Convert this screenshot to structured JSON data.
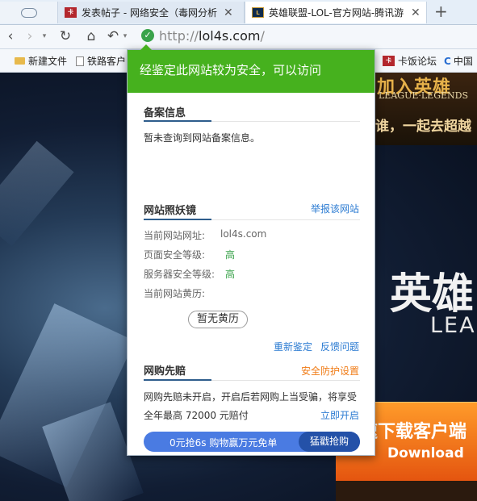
{
  "tabs": [
    {
      "label": "发表帖子 - 网络安全（毒网分析",
      "favicon": "forum-favicon",
      "active": false
    },
    {
      "label": "英雄联盟-LOL-官方网站-腾讯游",
      "favicon": "lol-favicon",
      "active": true
    }
  ],
  "address_bar": {
    "protocol": "http://",
    "host": "lol4s.com",
    "path": "/"
  },
  "bookmarks": [
    {
      "label": "新建文件"
    },
    {
      "label": "铁路客户"
    },
    {
      "label": "卡饭论坛"
    },
    {
      "label": "中国"
    }
  ],
  "page_background": {
    "banner_title": "加入英雄",
    "banner_subtitle": "LEAGUE·LEGENDS",
    "banner_slogan": "谁，一起去超越",
    "hero_title": "英雄",
    "hero_subtitle": "LEA",
    "download_text": "极速下载客户端",
    "download_label": "Download"
  },
  "popup": {
    "header": "经鉴定此网站较为安全，可以访问",
    "record": {
      "title": "备案信息",
      "text": "暂未查询到网站备案信息。"
    },
    "mirror": {
      "title": "网站照妖镜",
      "report_link": "举报该网站",
      "rows": [
        {
          "label": "当前网站网址:",
          "value": "lol4s.com"
        },
        {
          "label": "页面安全等级:",
          "value": "高"
        },
        {
          "label": "服务器安全等级:",
          "value": "高"
        },
        {
          "label": "当前网站黄历:",
          "value": ""
        }
      ],
      "no_history": "暂无黄历",
      "reidentify_link": "重新鉴定",
      "feedback_link": "反馈问题"
    },
    "shopping": {
      "title": "网购先赔",
      "settings_link": "安全防护设置",
      "line1": "网购先赔未开启，开启后若网购上当受骗，将享受",
      "line2": "全年最高 72000 元赔付",
      "enable_link": "立即开启"
    },
    "promo": {
      "text": "0元抢6s 购物赢万元免单",
      "button": "猛戳抢购"
    }
  },
  "colors": {
    "accent_green": "#46b11e",
    "link_blue": "#2b7bd2",
    "orange": "#f07b15",
    "promo_blue": "#4a7be2"
  }
}
